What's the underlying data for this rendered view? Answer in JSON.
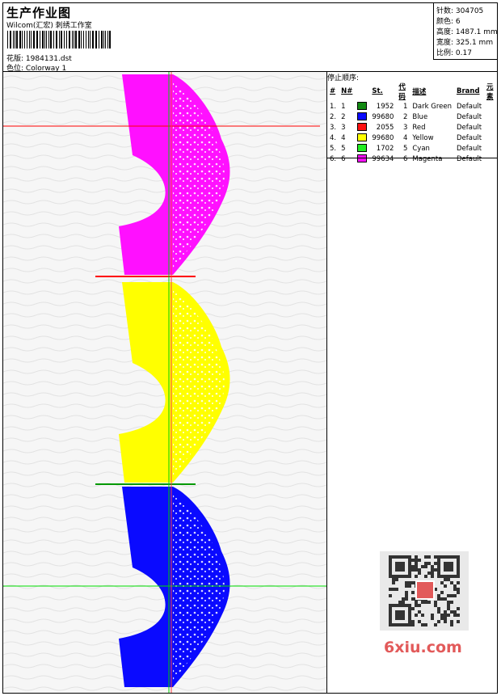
{
  "header": {
    "title": "生产作业图",
    "subtitle": "Wilcom(汇宏) 刺绣工作室",
    "design_label": "花版:",
    "design_file": "1984131.dst",
    "colorway_label": "色位:",
    "colorway": "Colorway 1"
  },
  "stats": [
    {
      "label": "针数:",
      "value": "304705"
    },
    {
      "label": "颜色:",
      "value": "6"
    },
    {
      "label": "高度:",
      "value": "1487.1 mm"
    },
    {
      "label": "宽度:",
      "value": "325.1 mm"
    },
    {
      "label": "比例:",
      "value": "0.17"
    }
  ],
  "stop_sequence": {
    "title": "停止顺序:",
    "columns": [
      "#",
      "N#",
      "St.",
      "代码",
      "描述",
      "Brand",
      "元素"
    ],
    "rows": [
      {
        "num": "1.",
        "n": "1",
        "color": "#128a12",
        "st": "1952",
        "code": "1",
        "desc": "Dark Green",
        "brand": "Default"
      },
      {
        "num": "2.",
        "n": "2",
        "color": "#0a0aff",
        "st": "99680",
        "code": "2",
        "desc": "Blue",
        "brand": "Default"
      },
      {
        "num": "3.",
        "n": "3",
        "color": "#ff1010",
        "st": "2055",
        "code": "3",
        "desc": "Red",
        "brand": "Default"
      },
      {
        "num": "4.",
        "n": "4",
        "color": "#ffff00",
        "st": "99680",
        "code": "4",
        "desc": "Yellow",
        "brand": "Default"
      },
      {
        "num": "5.",
        "n": "5",
        "color": "#22ee22",
        "st": "1702",
        "code": "5",
        "desc": "Cyan",
        "brand": "Default"
      },
      {
        "num": "6.",
        "n": "6",
        "color": "#ff10ff",
        "st": "99634",
        "code": "6",
        "desc": "Magenta",
        "brand": "Default"
      }
    ]
  },
  "canvas": {
    "motif_colors": [
      "#ff10ff",
      "#ffff00",
      "#0a0aff"
    ],
    "red_line_color": "#ff0000",
    "green_line_color": "#00dd00"
  },
  "watermark": {
    "text": "6xiu.com"
  }
}
